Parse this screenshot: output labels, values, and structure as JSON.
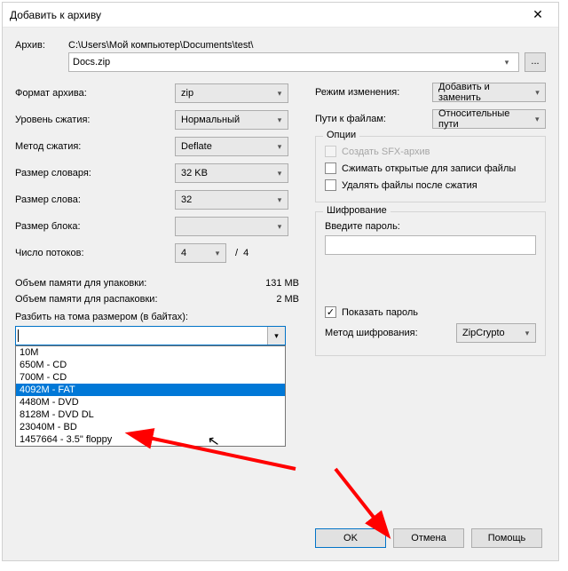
{
  "title": "Добавить к архиву",
  "archive": {
    "label": "Архив:",
    "path": "C:\\Users\\Мой компьютер\\Documents\\test\\",
    "file": "Docs.zip",
    "browse": "..."
  },
  "left": {
    "format": {
      "label": "Формат архива:",
      "value": "zip"
    },
    "level": {
      "label": "Уровень сжатия:",
      "value": "Нормальный"
    },
    "method": {
      "label": "Метод сжатия:",
      "value": "Deflate"
    },
    "dict": {
      "label": "Размер словаря:",
      "value": "32 KB"
    },
    "word": {
      "label": "Размер слова:",
      "value": "32"
    },
    "block": {
      "label": "Размер блока:",
      "value": ""
    },
    "threads": {
      "label": "Число потоков:",
      "value": "4",
      "max": "4"
    },
    "mem_pack": {
      "label": "Объем памяти для упаковки:",
      "value": "131 MB"
    },
    "mem_unpack": {
      "label": "Объем памяти для распаковки:",
      "value": "2 MB"
    },
    "split": {
      "label": "Разбить на тома размером (в байтах):",
      "value": "",
      "options": [
        "10M",
        "650M - CD",
        "700M - CD",
        "4092M - FAT",
        "4480M - DVD",
        "8128M - DVD DL",
        "23040M - BD",
        "1457664 - 3.5\" floppy"
      ],
      "selected_index": 3
    }
  },
  "right": {
    "mode": {
      "label": "Режим изменения:",
      "value": "Добавить и заменить"
    },
    "paths": {
      "label": "Пути к файлам:",
      "value": "Относительные пути"
    },
    "options_group": "Опции",
    "opt_sfx": "Создать SFX-архив",
    "opt_compress_open": "Сжимать открытые для записи файлы",
    "opt_delete": "Удалять файлы после сжатия",
    "enc_group": "Шифрование",
    "pwd_label": "Введите пароль:",
    "show_pwd": "Показать пароль",
    "show_pwd_checked": "✓",
    "enc_method": {
      "label": "Метод шифрования:",
      "value": "ZipCrypto"
    }
  },
  "buttons": {
    "ok": "OK",
    "cancel": "Отмена",
    "help": "Помощь"
  }
}
